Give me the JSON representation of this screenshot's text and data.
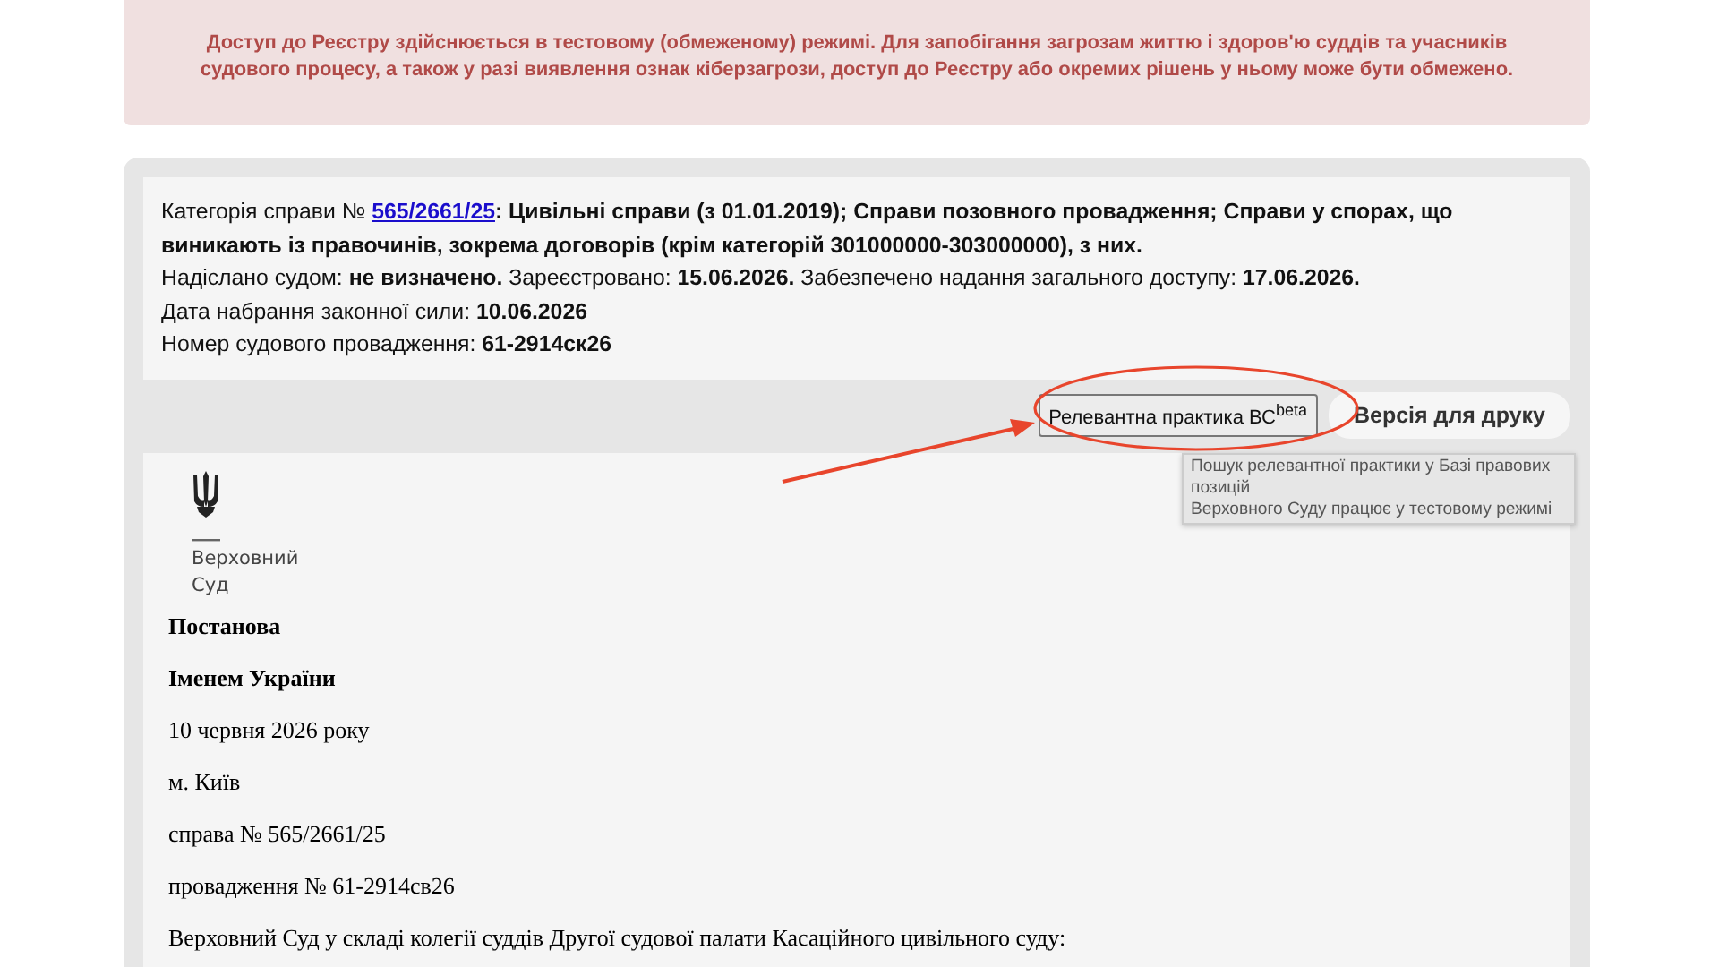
{
  "notice": "Доступ до Реєстру здійснюється в тестовому (обмеженому) режимі. Для запобігання загрозам життю і здоров'ю суддів та учасників судового процесу, а також у разі виявлення ознак кіберзагрози, доступ до Реєстру або окремих рішень у ньому може бути обмежено.",
  "case_info": {
    "category_label": "Категорія справи №",
    "case_link": "565/2661/25",
    "category_text": "**: Цивільні справи (з 01.01.2019); Справи позовного провадження; Справи у спорах, що виникають із правочинів, зокрема договорів (крім категорій 301000000-303000000), з них.**",
    "lines": [
      "Надіслано судом: **не визначено.** Зареєстровано: **15.06.2026.** Забезпечено надання загального доступу: **17.06.2026.**",
      "Дата набрання законної сили: **10.06.2026**",
      "Номер судового провадження: **61-2914ск26**"
    ]
  },
  "toolbar": {
    "buttons": [
      {
        "kind": "outlined",
        "label": "Релевантна практика ВС$^{beta}$"
      },
      {
        "kind": "pill",
        "label": "Версія для друку"
      }
    ],
    "tooltip": [
      "Пошук релевантної практики у Базі правових позицій",
      "Верховного Суду працює у тестовому режимі"
    ]
  },
  "document": {
    "logo_lines": [
      "Верховний",
      "Суд"
    ],
    "paragraphs": [
      {
        "kind": "bold",
        "text": "Постанова"
      },
      {
        "kind": "bold",
        "text": "Іменем України"
      },
      {
        "kind": "plain",
        "text": "10 червня 2026 року"
      },
      {
        "kind": "plain",
        "text": "м. Київ"
      },
      {
        "kind": "plain",
        "text": "справа № 565/2661/25"
      },
      {
        "kind": "plain",
        "text": "провадження № 61-2914св26"
      },
      {
        "kind": "plain",
        "text": "Верховний Суд у складі колегії суддів Другої судової палати Касаційного цивільного суду:"
      }
    ]
  }
}
